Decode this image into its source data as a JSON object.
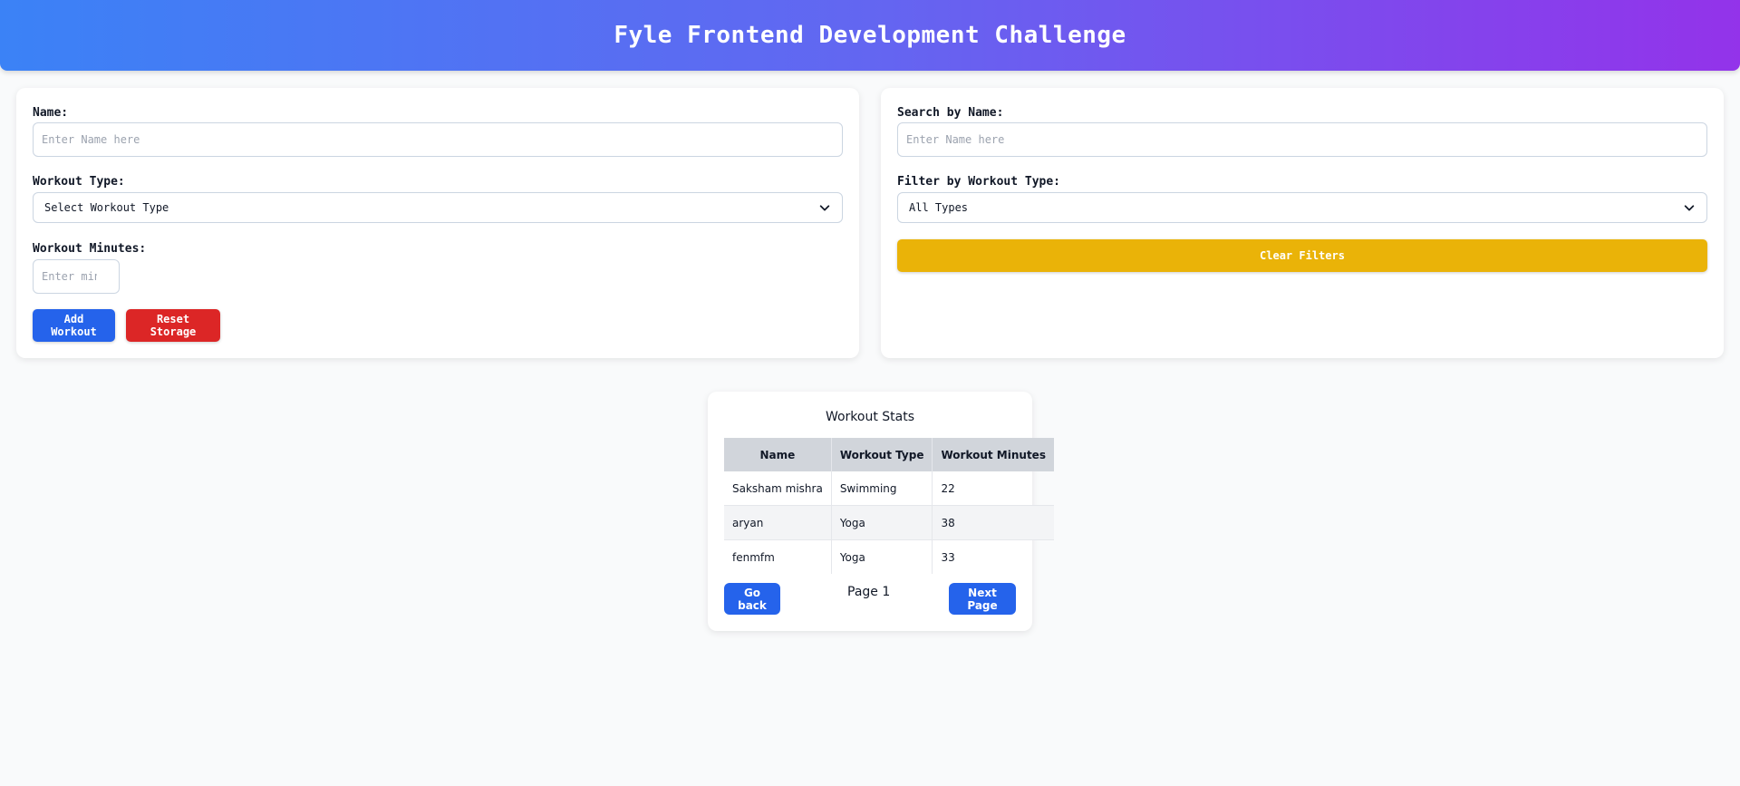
{
  "header": {
    "title": "Fyle Frontend Development Challenge"
  },
  "form": {
    "name_label": "Name:",
    "name_value": "",
    "name_placeholder": "Enter Name here",
    "workout_type_label": "Workout Type:",
    "workout_type_selected": "Select Workout Type",
    "workout_minutes_label": "Workout Minutes:",
    "workout_minutes_value": "",
    "workout_minutes_placeholder": "Enter mins",
    "add_button": "Add Workout",
    "reset_button": "Reset Storage"
  },
  "filters": {
    "search_label": "Search by Name:",
    "search_value": "",
    "search_placeholder": "Enter Name here",
    "filter_label": "Filter by Workout Type:",
    "filter_selected": "All Types",
    "clear_button": "Clear Filters"
  },
  "stats": {
    "title": "Workout Stats",
    "columns": [
      "Name",
      "Workout Type",
      "Workout Minutes"
    ],
    "rows": [
      [
        "Saksham mishra",
        "Swimming",
        "22"
      ],
      [
        "aryan",
        "Yoga",
        "38"
      ],
      [
        "fenmfm",
        "Yoga",
        "33"
      ]
    ],
    "back_button": "Go back",
    "page_label": "Page 1",
    "next_button": "Next Page"
  },
  "colors": {
    "primary_blue": "#2563eb",
    "danger_red": "#dc2626",
    "warning_yellow": "#eab308",
    "header_gradient_start": "#3b82f6",
    "header_gradient_end": "#9333ea"
  },
  "icons": {
    "select_chevron": "chevron-down-icon"
  }
}
